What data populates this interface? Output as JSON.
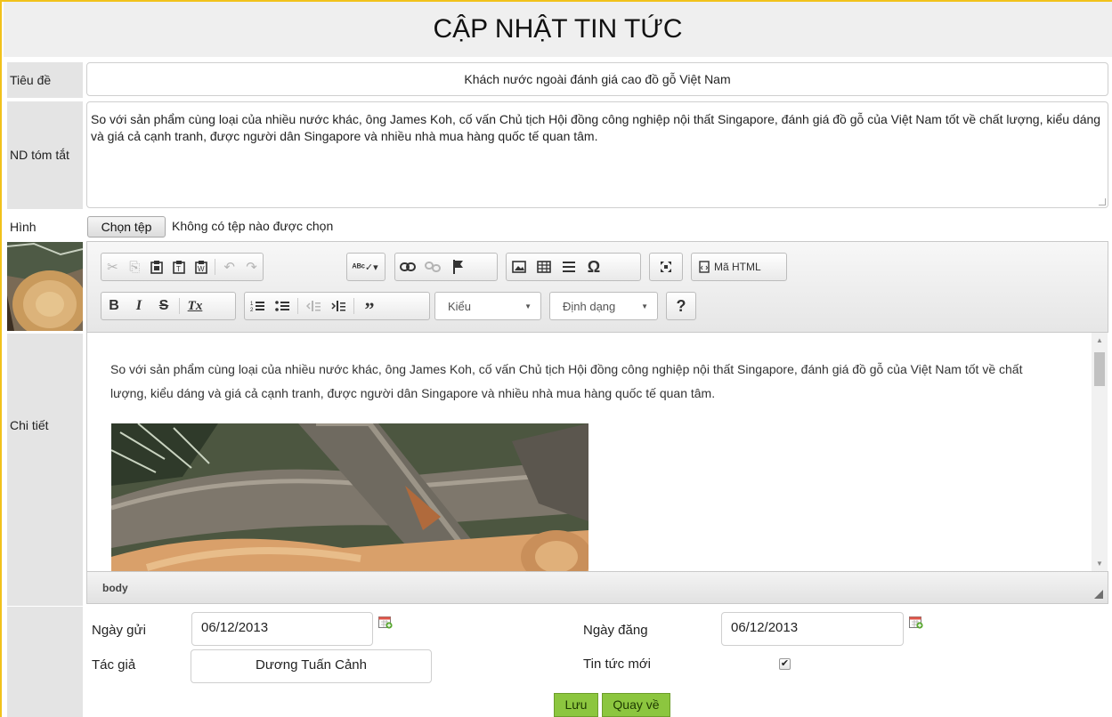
{
  "page": {
    "title": "CẬP NHẬT TIN TỨC"
  },
  "labels": {
    "title": "Tiêu đề",
    "summary": "ND tóm tắt",
    "image": "Hình",
    "detail": "Chi tiết"
  },
  "form": {
    "title_value": "Khách nước ngoài đánh giá cao đồ gỗ Việt Nam",
    "summary_value": "So với sản phẩm cùng loại của nhiều nước khác, ông James Koh, cố vấn Chủ tịch Hội đồng công nghiệp nội thất Singapore, đánh giá đồ gỗ của Việt Nam tốt về chất lượng, kiểu dáng và giá cả cạnh tranh, được người dân Singapore và nhiều nhà mua hàng quốc tế quan tâm.",
    "file_button": "Chọn tệp",
    "file_status": "Không có tệp nào được chọn"
  },
  "editor": {
    "source_label": "Mã HTML",
    "style_combo": "Kiểu",
    "format_combo": "Định dạng",
    "help_label": "?",
    "content_text": "So với sản phẩm cùng loại của nhiều nước khác, ông James Koh, cố vấn Chủ tịch Hội đồng công nghiệp nội thất Singapore, đánh giá đồ gỗ của Việt Nam tốt về chất lượng, kiểu dáng và giá cả cạnh tranh, được người dân Singapore và nhiều nhà mua hàng quốc tế quan tâm.",
    "status_path": "body",
    "toolbar_icons": [
      "cut-icon",
      "copy-icon",
      "paste-icon",
      "paste-text-icon",
      "paste-word-icon",
      "undo-icon",
      "redo-icon",
      "spellcheck-icon",
      "link-icon",
      "unlink-icon",
      "anchor-icon",
      "image-icon",
      "table-icon",
      "horizontal-rule-icon",
      "special-char-icon",
      "maximize-icon",
      "source-icon",
      "bold-icon",
      "italic-icon",
      "strike-icon",
      "remove-format-icon",
      "numbered-list-icon",
      "bulleted-list-icon",
      "outdent-icon",
      "indent-icon",
      "blockquote-icon"
    ]
  },
  "meta": {
    "sent_label": "Ngày gửi",
    "sent_value": "06/12/2013",
    "posted_label": "Ngày đăng",
    "posted_value": "06/12/2013",
    "author_label": "Tác giả",
    "author_value": "Dương Tuấn Cảnh",
    "new_label": "Tin tức mới",
    "new_checked": true
  },
  "actions": {
    "save": "Lưu",
    "back": "Quay về"
  },
  "colors": {
    "accent_border": "#f1c21b",
    "button_green": "#8cc63f",
    "label_bg": "#e4e4e4"
  }
}
